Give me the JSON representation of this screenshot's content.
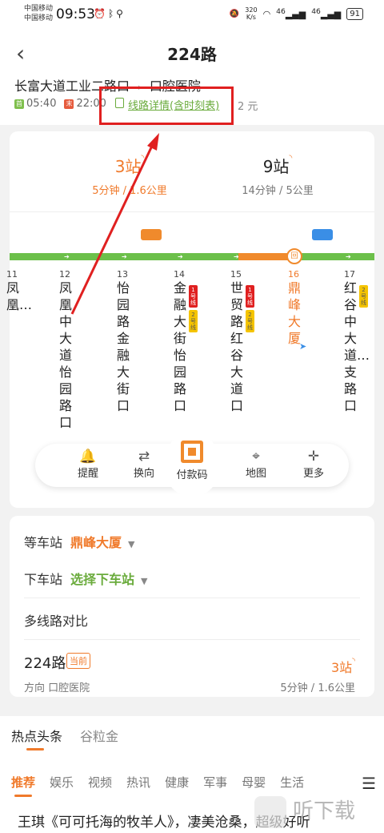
{
  "status": {
    "carrier1": "中国移动",
    "carrier2": "中国移动",
    "time": "09:53",
    "speed_value": "320",
    "speed_unit": "K/s",
    "net1": "46",
    "net2": "46",
    "battery": "91"
  },
  "header": {
    "title": "224路",
    "from": "长富大道工业二路口",
    "to": "口腔医院",
    "first_tag": "首",
    "first_time": "05:40",
    "last_tag": "末",
    "last_time": "22:00",
    "detail_link": "线路详情(含时刻表)",
    "price": "2 元"
  },
  "arrivals": [
    {
      "stations": "3站",
      "detail": "5分钟 / 1.6公里"
    },
    {
      "stations": "9站",
      "detail": "14分钟 / 5公里"
    }
  ],
  "stops": [
    {
      "num": "11",
      "name": "凤凰…"
    },
    {
      "num": "12",
      "name": "凤凰中大道怡园路口"
    },
    {
      "num": "13",
      "name": "怡园路金融大街口"
    },
    {
      "num": "14",
      "name": "金融大街怡园路口"
    },
    {
      "num": "15",
      "name": "世贸路红谷大道口"
    },
    {
      "num": "16",
      "name": "鼎峰大厦"
    },
    {
      "num": "17",
      "name": "红谷中大道…支路口"
    }
  ],
  "line_badges": {
    "l1": "1号线",
    "l2": "2号线"
  },
  "stop_marker": "回",
  "actions": {
    "remind": "提醒",
    "reverse": "换向",
    "pay": "付款码",
    "map": "地图",
    "more": "更多"
  },
  "waiting": {
    "label": "等车站",
    "value": "鼎峰大厦"
  },
  "alight": {
    "label": "下车站",
    "value": "选择下车站"
  },
  "compare": {
    "label": "多线路对比"
  },
  "route_row": {
    "name": "224路",
    "badge": "当前",
    "direction": "方向 口腔医院",
    "stations": "3站",
    "detail": "5分钟 / 1.6公里"
  },
  "news_tabs": [
    "热点头条",
    "谷粒金"
  ],
  "categories": [
    "推荐",
    "娱乐",
    "视频",
    "热讯",
    "健康",
    "军事",
    "母婴",
    "生活"
  ],
  "headline": "王琪《可可托海的牧羊人》，凄美沧桑，超级好听",
  "watermark": "听下载",
  "colors": {
    "accent": "#f07a2b",
    "green": "#6cc04a",
    "annotation": "#e02020"
  }
}
